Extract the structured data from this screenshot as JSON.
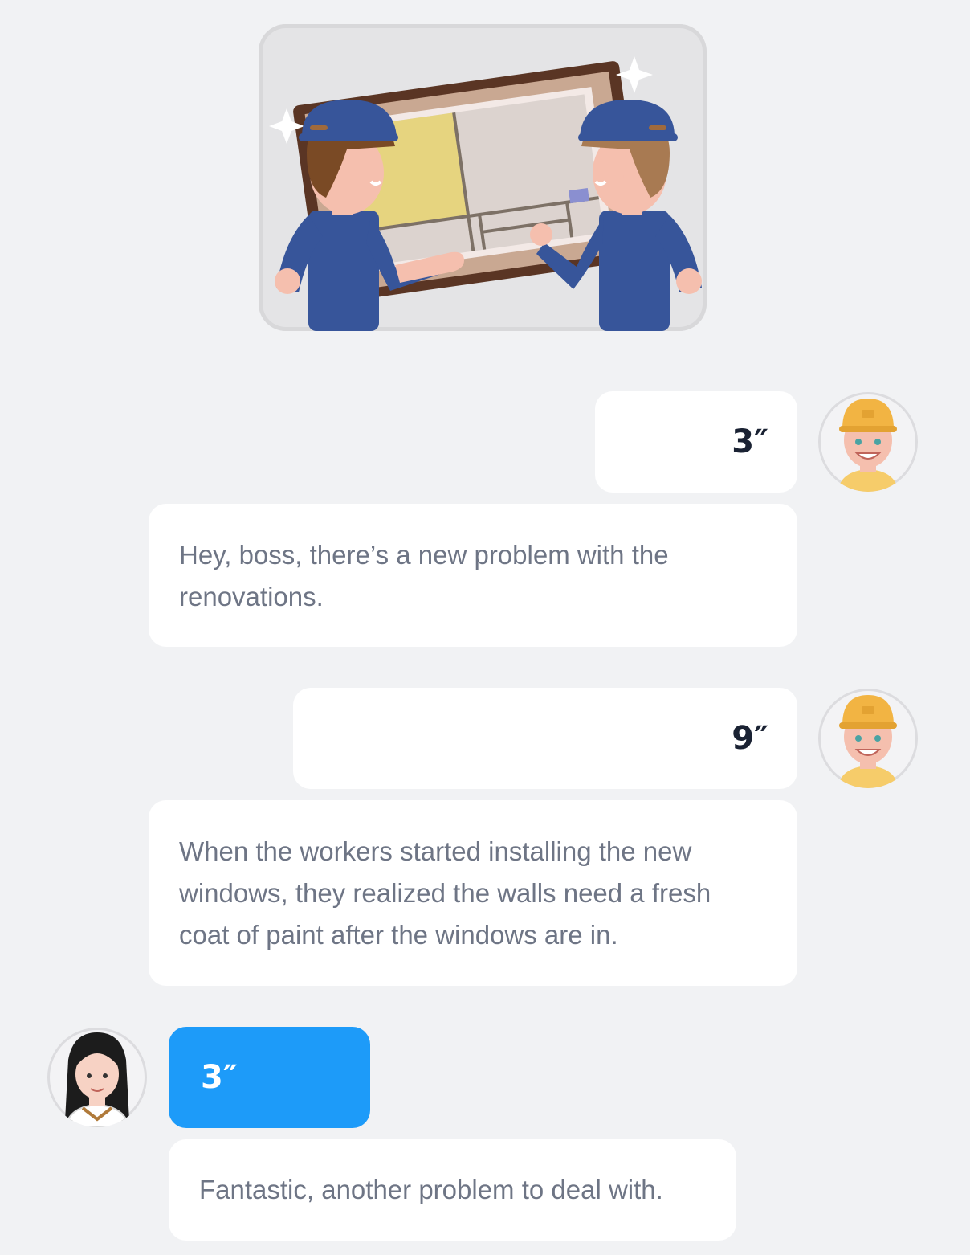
{
  "illustration": {
    "icon": "workers-installing-window-illustration"
  },
  "messages": [
    {
      "side": "right",
      "speaker": "worker",
      "audio_duration": "3″",
      "text": "Hey, boss, there’s a new problem with the renovations."
    },
    {
      "side": "right",
      "speaker": "worker",
      "audio_duration": "9″",
      "text": "When the workers started installing the new windows, they realized the walls need a fresh coat of paint after the windows are in."
    },
    {
      "side": "left",
      "speaker": "boss",
      "audio_duration": "3″",
      "text": "Fantastic, another problem to deal with."
    }
  ],
  "colors": {
    "background": "#f1f2f4",
    "bubble": "#ffffff",
    "accent_blue": "#1d9bf9",
    "text_gray": "#6e7585"
  }
}
